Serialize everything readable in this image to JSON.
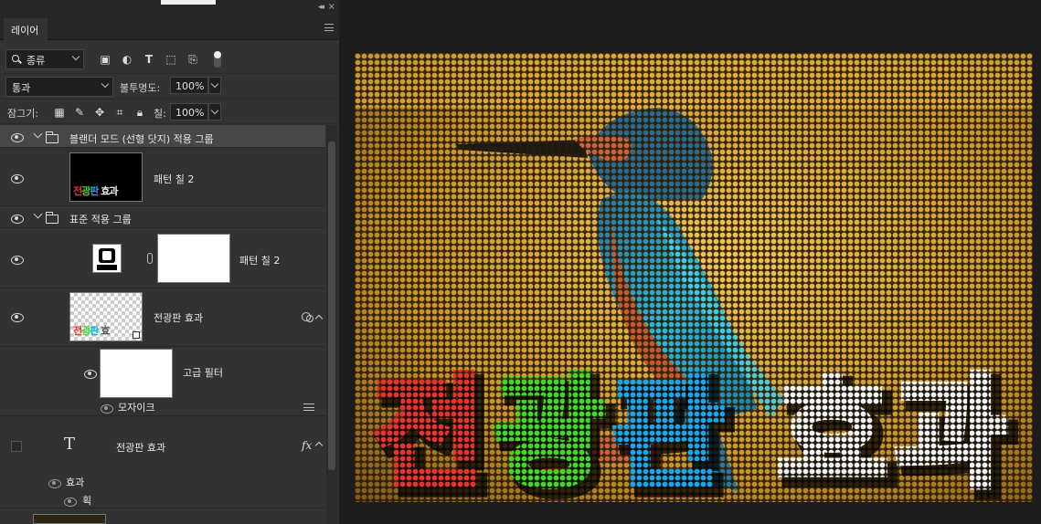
{
  "panel": {
    "tab": "레이어",
    "kind_filter": "종류",
    "blend_mode": "통과",
    "opacity_label": "불투명도:",
    "opacity_value": "100%",
    "lock_label": "잠그기:",
    "fill_label": "칠:",
    "fill_value": "100%"
  },
  "layers": {
    "group1": "블랜더 모드 (선형 닷지) 적용 그룹",
    "pattern1": "패턴 칠 2",
    "pattern1_thumb": [
      "전",
      "광",
      "판",
      " 효과"
    ],
    "group2": "표준 적용 그룹",
    "pattern2": "패턴 칠 2",
    "smart": "전광판 효과",
    "smart_thumb": [
      "전",
      "광",
      "판",
      " 효"
    ],
    "smart_filter": "고급 필터",
    "mosaic": "모자이크",
    "text_layer": "전광판 효과",
    "effects": "효과",
    "stroke": "획"
  },
  "canvas": {
    "headline": [
      {
        "char": "전",
        "color": "#e8342f"
      },
      {
        "char": "광",
        "color": "#44d62c"
      },
      {
        "char": "판",
        "color": "#1aa6ec"
      },
      {
        "char": "효",
        "color": "#f4f4f4"
      },
      {
        "char": "과",
        "color": "#f4f4f4"
      }
    ],
    "background_color": "#d7a235",
    "dot_color": "#f2c14a",
    "bird_colors": {
      "head": "#2d6a8c",
      "breast": "#c9653a",
      "back": "#2fa6c7",
      "beak": "#1a1a1a"
    }
  }
}
